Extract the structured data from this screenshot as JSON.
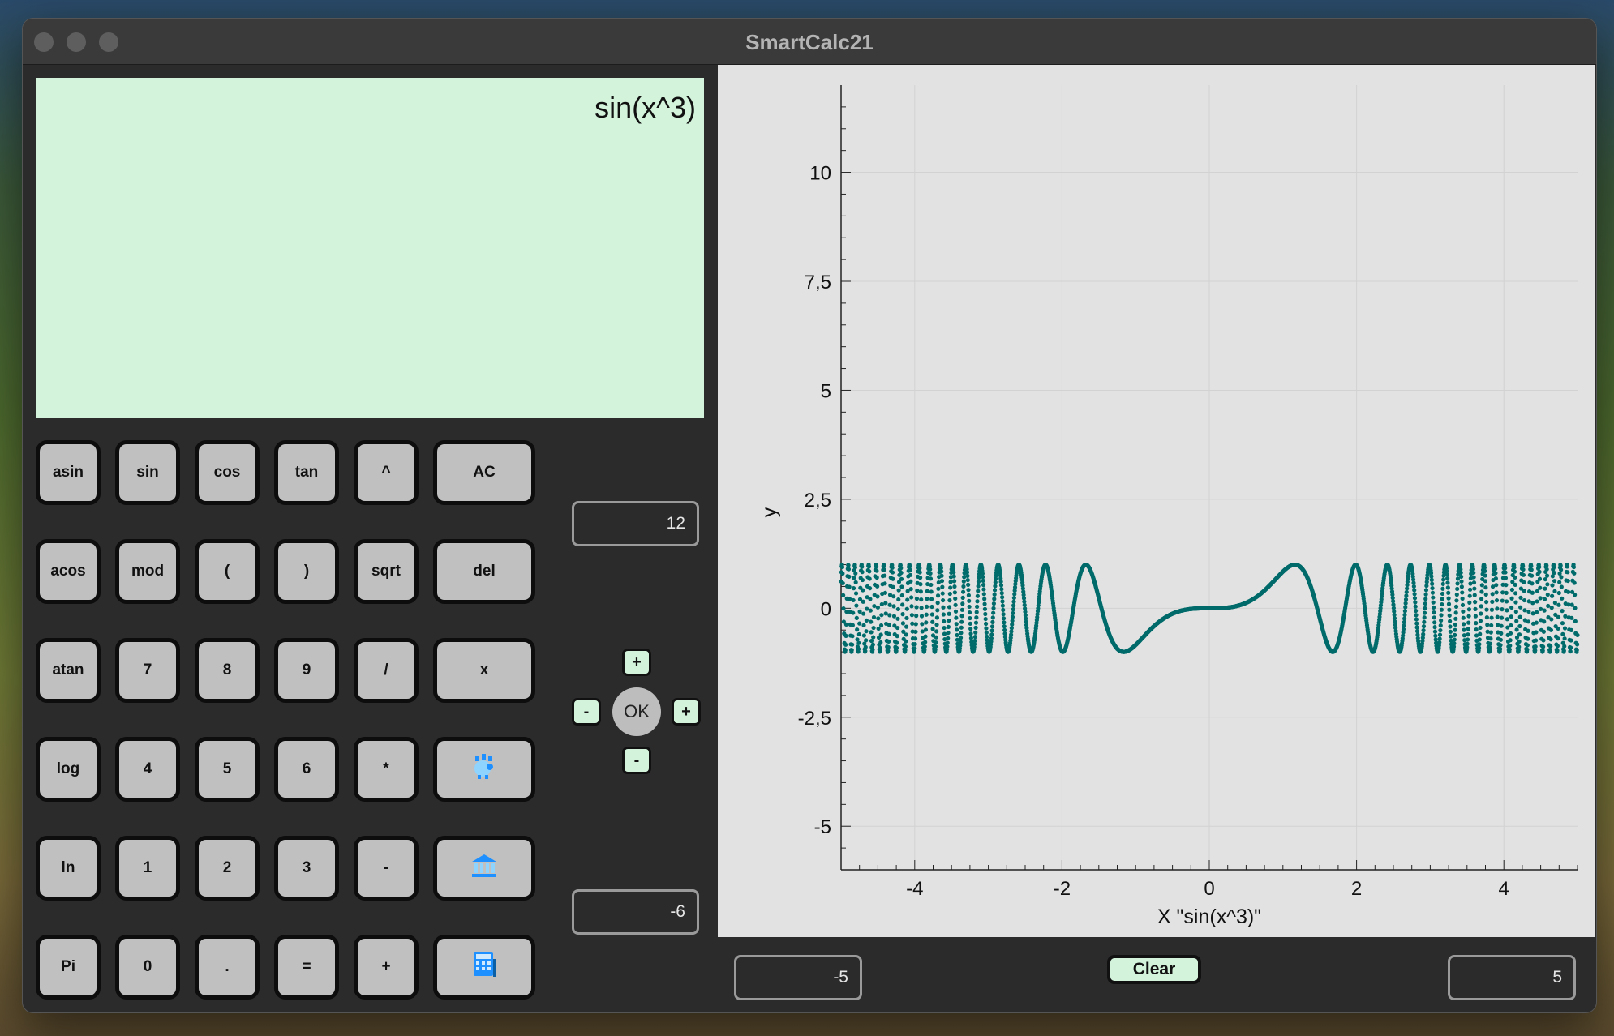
{
  "window": {
    "title": "SmartCalc21"
  },
  "display": {
    "expression": "sin(x^3)"
  },
  "keys": [
    [
      "asin",
      "sin",
      "cos",
      "tan",
      "^",
      "AC"
    ],
    [
      "acos",
      "mod",
      "(",
      ")",
      "sqrt",
      "del"
    ],
    [
      "atan",
      "7",
      "8",
      "9",
      "/",
      "x"
    ],
    [
      "log",
      "4",
      "5",
      "6",
      "*",
      ""
    ],
    [
      "ln",
      "1",
      "2",
      "3",
      "-",
      ""
    ],
    [
      "Pi",
      "0",
      ".",
      "=",
      "+",
      ""
    ]
  ],
  "special_keys": {
    "credit_icon": "piggy-bank-icon",
    "deposit_icon": "bank-icon",
    "calculator_icon": "calculator-icon"
  },
  "range": {
    "y_max": "12",
    "y_min": "-6",
    "x_min": "-5",
    "x_max": "5",
    "ok_label": "OK",
    "plus_label": "+",
    "minus_label": "-"
  },
  "plot": {
    "clear_label": "Clear"
  },
  "chart_data": {
    "type": "scatter",
    "function": "sin(x^3)",
    "xlabel": "X \"sin(x^3)\"",
    "ylabel": "y",
    "xlim": [
      -5,
      5
    ],
    "ylim": [
      -6,
      12
    ],
    "x_ticks": [
      "-4",
      "-2",
      "0",
      "2",
      "4"
    ],
    "y_ticks": [
      "10",
      "7,5",
      "5",
      "2,5",
      "0",
      "-2,5",
      "-5"
    ],
    "series_color": "#006b6b",
    "grid": true
  },
  "colors": {
    "display_bg": "#d3f3db",
    "key_bg": "#c0c0c0",
    "plot_bg": "#e2e2e2",
    "series": "#006b6b"
  }
}
